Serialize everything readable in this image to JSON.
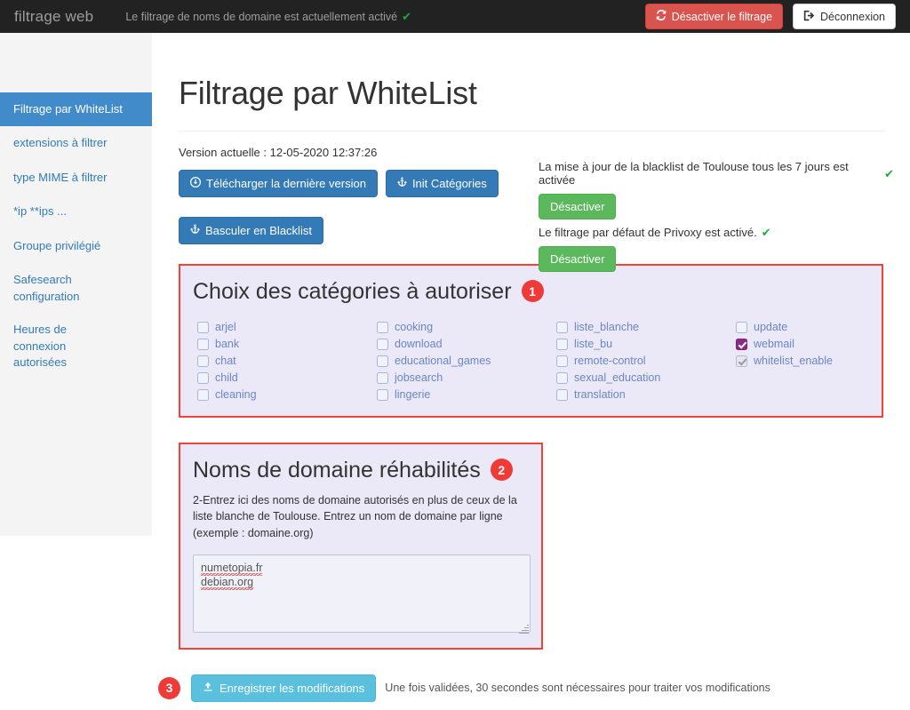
{
  "navbar": {
    "brand": "filtrage web",
    "status_text": "Le filtrage de noms de domaine est actuellement activé",
    "status_check": "✔",
    "disable_filter_label": "Désactiver le filtrage",
    "disable_filter_icon": "refresh-icon",
    "logout_label": "Déconnexion",
    "logout_icon": "logout-icon",
    "danger_color": "#d9534f"
  },
  "sidebar": {
    "items": [
      {
        "label": "Filtrage par WhiteList",
        "active": true
      },
      {
        "label": "extensions à filtrer",
        "active": false
      },
      {
        "label": "type MIME à filtrer",
        "active": false
      },
      {
        "label": "*ip **ips ...",
        "active": false
      },
      {
        "label": "Groupe privilégié",
        "active": false
      },
      {
        "label": "Safesearch configuration",
        "active": false
      },
      {
        "label": "Heures de connexion autorisées",
        "active": false
      }
    ],
    "active_color": "#428bca"
  },
  "main": {
    "page_title": "Filtrage par WhiteList",
    "version_line": "Version actuelle : 12-05-2020 12:37:26",
    "download_button": "Télécharger la dernière version",
    "download_icon": "download-circle-icon",
    "init_categories_button": "Init Catégories",
    "init_icon": "anchor-icon",
    "switch_blacklist_button": "Basculer en Blacklist",
    "switch_icon": "anchor-icon"
  },
  "toggles": {
    "blacklist_update_text": "La mise à jour de la blacklist de Toulouse tous les 7 jours est activée",
    "blacklist_update_check": "✔",
    "blacklist_disable_button": "Désactiver",
    "privoxy_text": "Le filtrage par défaut de Privoxy est activé.",
    "privoxy_check": "✔",
    "privoxy_disable_button": "Désactiver",
    "success_color": "#5cb85c"
  },
  "categories_panel": {
    "title": "Choix des catégories à autoriser",
    "badge": "1",
    "border_color": "#f44336",
    "background_color": "#ebe9f7",
    "checked_color": "#8a2b8a",
    "columns": [
      [
        {
          "label": "arjel",
          "checked": false,
          "disabled": false
        },
        {
          "label": "bank",
          "checked": false,
          "disabled": false
        },
        {
          "label": "chat",
          "checked": false,
          "disabled": false
        },
        {
          "label": "child",
          "checked": false,
          "disabled": false
        },
        {
          "label": "cleaning",
          "checked": false,
          "disabled": false
        }
      ],
      [
        {
          "label": "cooking",
          "checked": false,
          "disabled": false
        },
        {
          "label": "download",
          "checked": false,
          "disabled": false
        },
        {
          "label": "educational_games",
          "checked": false,
          "disabled": false
        },
        {
          "label": "jobsearch",
          "checked": false,
          "disabled": false
        },
        {
          "label": "lingerie",
          "checked": false,
          "disabled": false
        }
      ],
      [
        {
          "label": "liste_blanche",
          "checked": false,
          "disabled": false
        },
        {
          "label": "liste_bu",
          "checked": false,
          "disabled": false
        },
        {
          "label": "remote-control",
          "checked": false,
          "disabled": false
        },
        {
          "label": "sexual_education",
          "checked": false,
          "disabled": false
        },
        {
          "label": "translation",
          "checked": false,
          "disabled": false
        }
      ],
      [
        {
          "label": "update",
          "checked": false,
          "disabled": false
        },
        {
          "label": "webmail",
          "checked": true,
          "disabled": false
        },
        {
          "label": "whitelist_enable",
          "checked": true,
          "disabled": true
        }
      ]
    ]
  },
  "domain_panel": {
    "title": "Noms de domaine réhabilités",
    "badge": "2",
    "description": "2-Entrez ici des noms de domaine autorisés en plus de ceux de la liste blanche de Toulouse. Entrez un nom de domaine par ligne (exemple : domaine.org)",
    "textarea_value": "numetopia.fr\ndebian.org",
    "textarea_lines": [
      "numetopia.fr",
      "debian.org"
    ],
    "textarea_placeholder": ""
  },
  "save_row": {
    "badge": "3",
    "button_label": "Enregistrer les modifications",
    "button_icon": "upload-icon",
    "note": "Une fois validées, 30 secondes sont nécessaires pour traiter vos modifications",
    "button_color": "#5bc0de"
  }
}
